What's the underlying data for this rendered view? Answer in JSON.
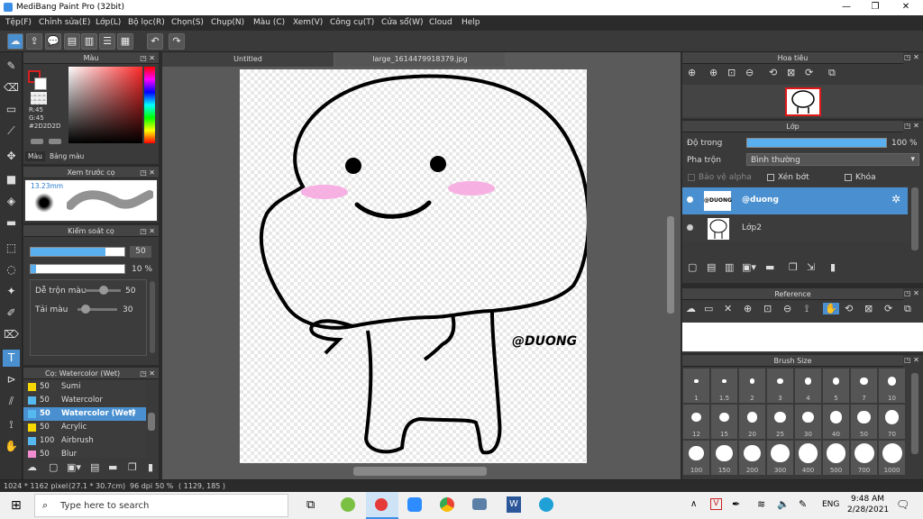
{
  "app": {
    "title": "MediBang Paint Pro (32bit)"
  },
  "menu": [
    "Tệp(F)",
    "Chỉnh sửa(E)",
    "Lớp(L)",
    "Bộ lọc(R)",
    "Chọn(S)",
    "Chụp(N)",
    "Màu (C)",
    "Xem(V)",
    "Công cụ(T)",
    "Cửa sổ(W)",
    "Cloud",
    "Help"
  ],
  "color_panel": {
    "title": "Màu",
    "r": "R:45",
    "g": "G:45",
    "hex": "#2D2D2D",
    "tab1": "Màu",
    "tab2": "Bảng màu",
    "accent": "#d42020"
  },
  "brush_preview": {
    "title": "Xem trước cọ",
    "size": "13.23mm"
  },
  "brush_control": {
    "title": "Kiểm soát cọ",
    "size_val": "50",
    "opacity_val": "10 %",
    "blend_label": "Dễ trộn màu",
    "blend_val": "50",
    "color_label": "Tải màu",
    "color_val": "30",
    "size_fill": 0.8,
    "opacity_fill": 0.06
  },
  "brush_list": {
    "title": "Cọ: Watercolor (Wet)",
    "items": [
      {
        "size": "50",
        "name": "Sumi",
        "color": "#f5d800"
      },
      {
        "size": "50",
        "name": "Watercolor",
        "color": "#55b8ef"
      },
      {
        "size": "50",
        "name": "Watercolor (Wet)",
        "color": "#55b8ef",
        "selected": true
      },
      {
        "size": "50",
        "name": "Acrylic",
        "color": "#f5d800"
      },
      {
        "size": "100",
        "name": "Airbrush",
        "color": "#55b8ef"
      },
      {
        "size": "50",
        "name": "Blur",
        "color": "#f08cd0"
      }
    ]
  },
  "document": {
    "tab1": "Untitled",
    "tab2": "large_1614479918379.jpg",
    "watermark": "@DUONG"
  },
  "navigator": {
    "title": "Hoa tiêu"
  },
  "layers": {
    "title": "Lớp",
    "opacity_label": "Độ trong",
    "opacity_val": "100 %",
    "opacity_fill": 1.0,
    "blend_label": "Pha trộn",
    "blend_val": "Bình thường",
    "protect_alpha": "Bảo vệ alpha",
    "clipping": "Xén bớt",
    "lock": "Khóa",
    "items": [
      {
        "name": "@duong",
        "thumb": "@DUONG",
        "selected": true
      },
      {
        "name": "Lớp2",
        "thumb": "",
        "selected": false
      }
    ]
  },
  "reference": {
    "title": "Reference"
  },
  "brush_size": {
    "title": "Brush Size",
    "sizes": [
      "1",
      "1.5",
      "2",
      "3",
      "4",
      "5",
      "7",
      "10",
      "12",
      "15",
      "20",
      "25",
      "30",
      "40",
      "50",
      "70",
      "100",
      "150",
      "200",
      "300",
      "400",
      "500",
      "700",
      "1000"
    ]
  },
  "status": {
    "dims": "1024 * 1162 pixel",
    "cm": "(27.1 * 30.7cm)",
    "dpi": "96 dpi",
    "zoom": "50 %",
    "coord": "( 1129, 185 )"
  },
  "taskbar": {
    "search": "Type here to search",
    "lang": "ENG",
    "time": "9:48 AM",
    "date": "2/28/2021"
  }
}
